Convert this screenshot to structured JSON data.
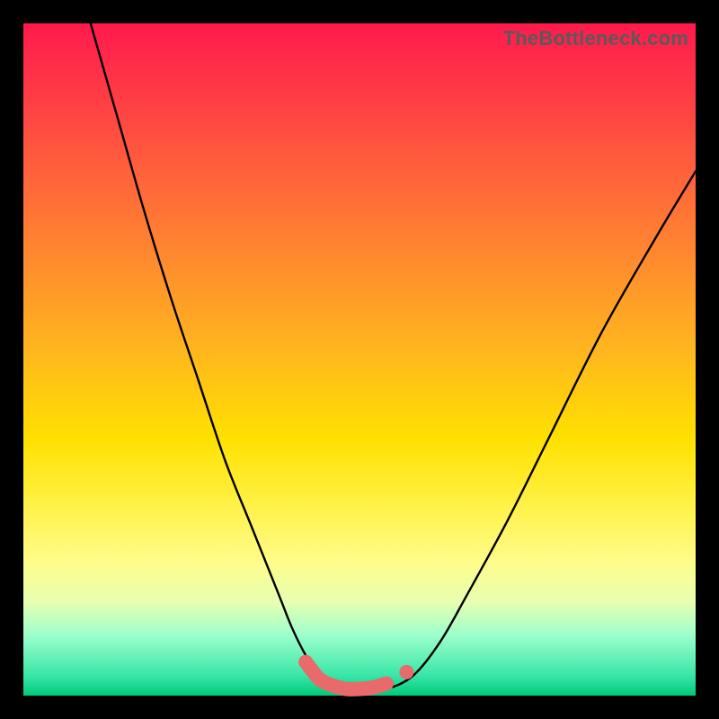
{
  "watermark": "TheBottleneck.com",
  "chart_data": {
    "type": "line",
    "title": "",
    "xlabel": "",
    "ylabel": "",
    "xlim": [
      0,
      100
    ],
    "ylim": [
      0,
      100
    ],
    "series": [
      {
        "name": "bottleneck-curve",
        "x": [
          10,
          14,
          18,
          22,
          26,
          30,
          34,
          38,
          40,
          42,
          44,
          46,
          48,
          50,
          54,
          58,
          62,
          66,
          72,
          78,
          86,
          94,
          100
        ],
        "y": [
          100,
          86,
          72,
          59,
          47,
          35,
          25,
          15,
          10,
          6,
          3,
          1.5,
          1,
          1,
          1,
          3,
          8,
          15,
          26,
          38,
          54,
          68,
          78
        ]
      }
    ],
    "highlight": {
      "name": "optimal-range",
      "x": [
        42,
        44,
        46,
        48,
        50,
        52,
        54
      ],
      "y": [
        5,
        2.5,
        1.5,
        1,
        1,
        1.2,
        1.8
      ]
    },
    "highlight_dot": {
      "x": 57,
      "y": 3.5
    },
    "background_gradient": {
      "top": "#ff1a4d",
      "mid": "#ffe100",
      "bottom": "#00c97a"
    }
  }
}
